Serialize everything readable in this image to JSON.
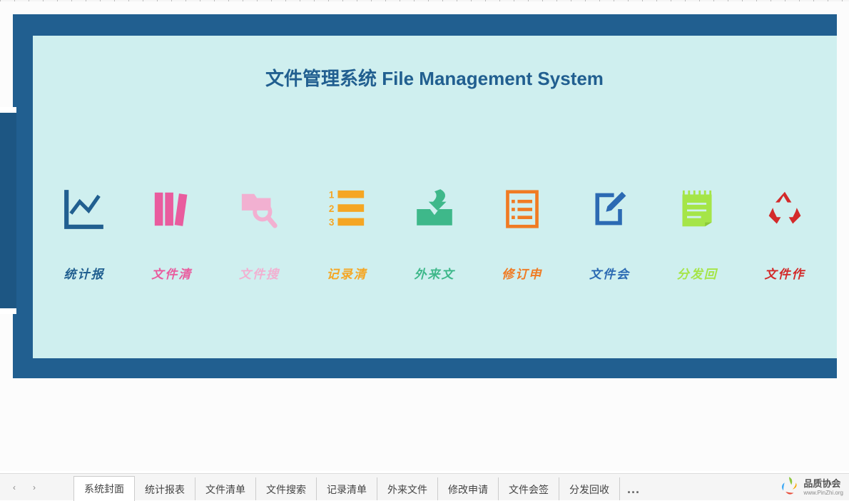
{
  "title": "文件管理系统 File Management System",
  "icons": [
    {
      "name": "stats-chart-icon",
      "label": "统计报",
      "color": "c-blue"
    },
    {
      "name": "files-icon",
      "label": "文件清",
      "color": "c-pink"
    },
    {
      "name": "search-folder-icon",
      "label": "文件搜",
      "color": "c-lpink"
    },
    {
      "name": "list-icon",
      "label": "记录清",
      "color": "c-orange"
    },
    {
      "name": "inbox-icon",
      "label": "外来文",
      "color": "c-green"
    },
    {
      "name": "checklist-icon",
      "label": "修订申",
      "color": "c-orange2"
    },
    {
      "name": "edit-icon",
      "label": "文件会",
      "color": "c-blue2"
    },
    {
      "name": "notepad-icon",
      "label": "分发回",
      "color": "c-lime"
    },
    {
      "name": "recycle-icon",
      "label": "文件作",
      "color": "c-red"
    }
  ],
  "tabs": [
    {
      "label": "系统封面",
      "active": true
    },
    {
      "label": "统计报表",
      "active": false
    },
    {
      "label": "文件清单",
      "active": false
    },
    {
      "label": "文件搜索",
      "active": false
    },
    {
      "label": "记录清单",
      "active": false
    },
    {
      "label": "外来文件",
      "active": false
    },
    {
      "label": "修改申请",
      "active": false
    },
    {
      "label": "文件会签",
      "active": false
    },
    {
      "label": "分发回收",
      "active": false
    }
  ],
  "more_label": "···",
  "logo": {
    "cn": "品质协会",
    "en": "www.PinZhi.org"
  }
}
